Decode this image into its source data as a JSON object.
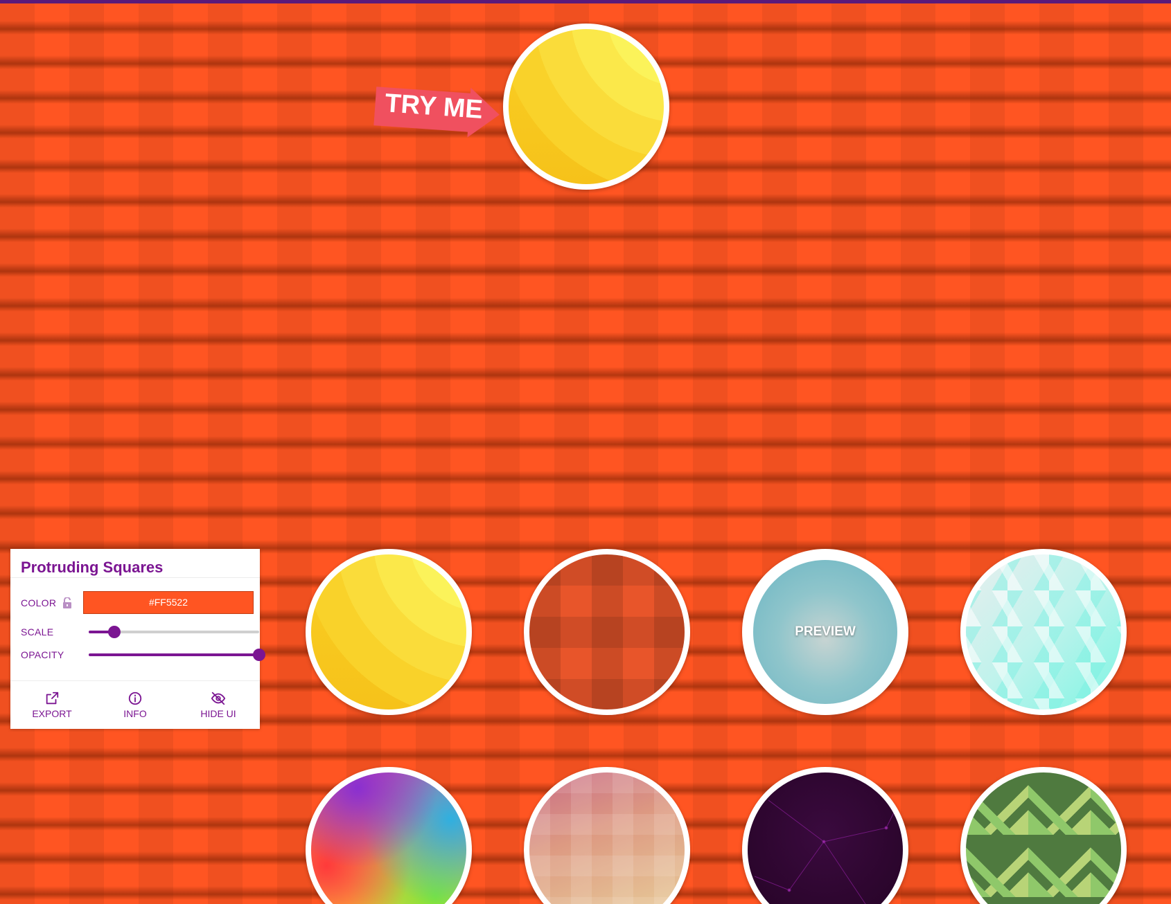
{
  "app": {
    "pattern_name": "Protruding Squares",
    "background_color": "#FF5522",
    "accent_color": "#7B1592"
  },
  "callout": {
    "label": "TRY ME"
  },
  "controls": {
    "color_label": "COLOR",
    "color_value": "#FF5522",
    "scale_label": "SCALE",
    "scale_level": 0.15,
    "opacity_label": "OPACITY",
    "opacity_level": 1.0
  },
  "footer": {
    "export_label": "EXPORT",
    "info_label": "INFO",
    "hide_label": "HIDE UI"
  },
  "previews": [
    {
      "pattern": "sun"
    },
    {
      "pattern": "squares"
    },
    {
      "pattern": "teal",
      "hover_label": "PREVIEW"
    },
    {
      "pattern": "triangles"
    },
    {
      "pattern": "rainbow"
    },
    {
      "pattern": "pastel-squares"
    },
    {
      "pattern": "space"
    },
    {
      "pattern": "green-diamonds"
    }
  ]
}
